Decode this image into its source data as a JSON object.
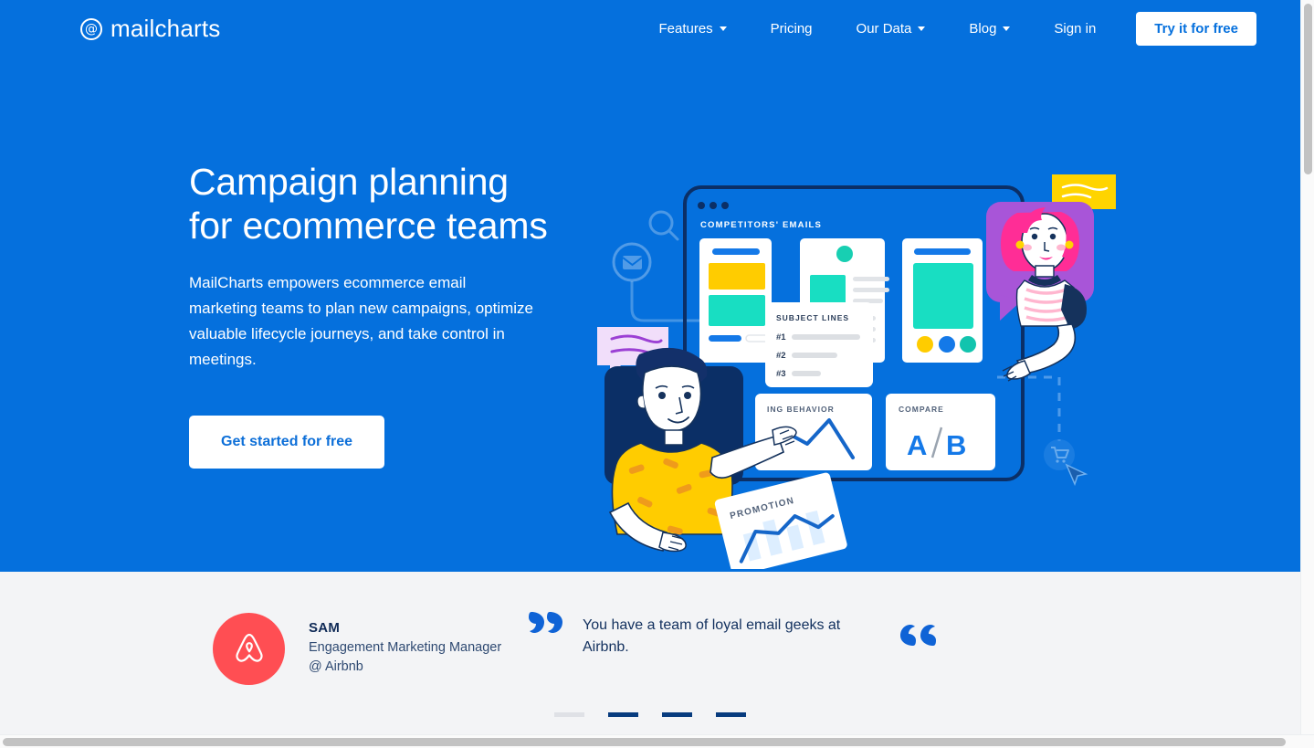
{
  "brand": {
    "logo_text": "mailcharts",
    "logo_mark": "at-symbol-icon",
    "blue": "#0570dd",
    "navy": "#0f2a56",
    "light_gray": "#f3f4f6",
    "airbnb_red": "#ff4e53"
  },
  "nav": {
    "items": [
      {
        "label": "Features",
        "has_caret": true
      },
      {
        "label": "Pricing",
        "has_caret": false
      },
      {
        "label": "Our Data",
        "has_caret": true
      },
      {
        "label": "Blog",
        "has_caret": true
      },
      {
        "label": "Sign in",
        "has_caret": false
      }
    ],
    "cta_label": "Try it for free"
  },
  "hero": {
    "title": "Campaign planning\nfor ecommerce teams",
    "subtitle": "MailCharts empowers ecommerce email marketing teams to plan new campaigns, optimize valuable lifecycle journeys, and take control in meetings.",
    "cta_label": "Get started for free"
  },
  "illustration": {
    "window_label": "COMPETITORS' EMAILS",
    "subject_lines": {
      "title": "SUBJECT LINES",
      "items": [
        "#1",
        "#2",
        "#3"
      ]
    },
    "behavior_card_label": "ING BEHAVIOR",
    "compare_card": {
      "label": "COMPARE",
      "a": "A",
      "divider": "/",
      "b": "B"
    },
    "promotion_card_label": "PROMOTION",
    "decor_icons": [
      "search-icon",
      "envelope-icon",
      "shopping-cart-icon",
      "cursor-arrow-icon"
    ]
  },
  "testimonial": {
    "avatar_icon": "airbnb-logo-icon",
    "name": "SAM",
    "role": "Engagement Marketing Manager",
    "company": "@ Airbnb",
    "quote": "You have a team of loyal email geeks at Airbnb.",
    "quote_open_glyph": "“",
    "quote_close_glyph": "”",
    "slides": [
      {
        "active": false
      },
      {
        "active": true
      },
      {
        "active": true
      },
      {
        "active": true
      }
    ]
  }
}
